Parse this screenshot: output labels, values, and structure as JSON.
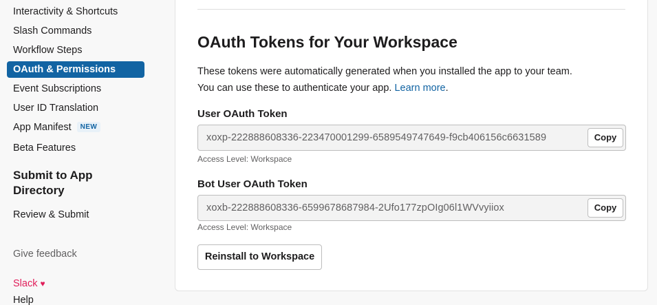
{
  "sidebar": {
    "items": [
      {
        "label": "Interactivity & Shortcuts"
      },
      {
        "label": "Slash Commands"
      },
      {
        "label": "Workflow Steps"
      },
      {
        "label": "OAuth & Permissions"
      },
      {
        "label": "Event Subscriptions"
      },
      {
        "label": "User ID Translation"
      },
      {
        "label": "App Manifest",
        "badge": "NEW"
      },
      {
        "label": "Beta Features"
      }
    ],
    "submit_heading": "Submit to App Directory",
    "submit_heading_line1": "Submit to App",
    "submit_heading_line2": "Directory",
    "review_submit": "Review & Submit",
    "give_feedback": "Give feedback",
    "slack": "Slack",
    "heart": "♥",
    "help": "Help"
  },
  "main": {
    "title": "OAuth Tokens for Your Workspace",
    "description_line1": "These tokens were automatically generated when you installed the app to your team.",
    "description_line2": "You can use these to authenticate your app.",
    "learn_more": "Learn more",
    "period": ".",
    "user_token": {
      "label": "User OAuth Token",
      "value": "xoxp-222888608336-223470001299-6589549747649-f9cb406156c6631589",
      "copy_label": "Copy",
      "access_level": "Access Level: Workspace"
    },
    "bot_token": {
      "label": "Bot User OAuth Token",
      "value": "xoxb-222888608336-6599678687984-2Ufo177zpOIg06l1WVvyiiox",
      "copy_label": "Copy",
      "access_level": "Access Level: Workspace"
    },
    "reinstall_label": "Reinstall to Workspace"
  },
  "colors": {
    "accent": "#1264a3",
    "slack_pink": "#e01e5a"
  }
}
